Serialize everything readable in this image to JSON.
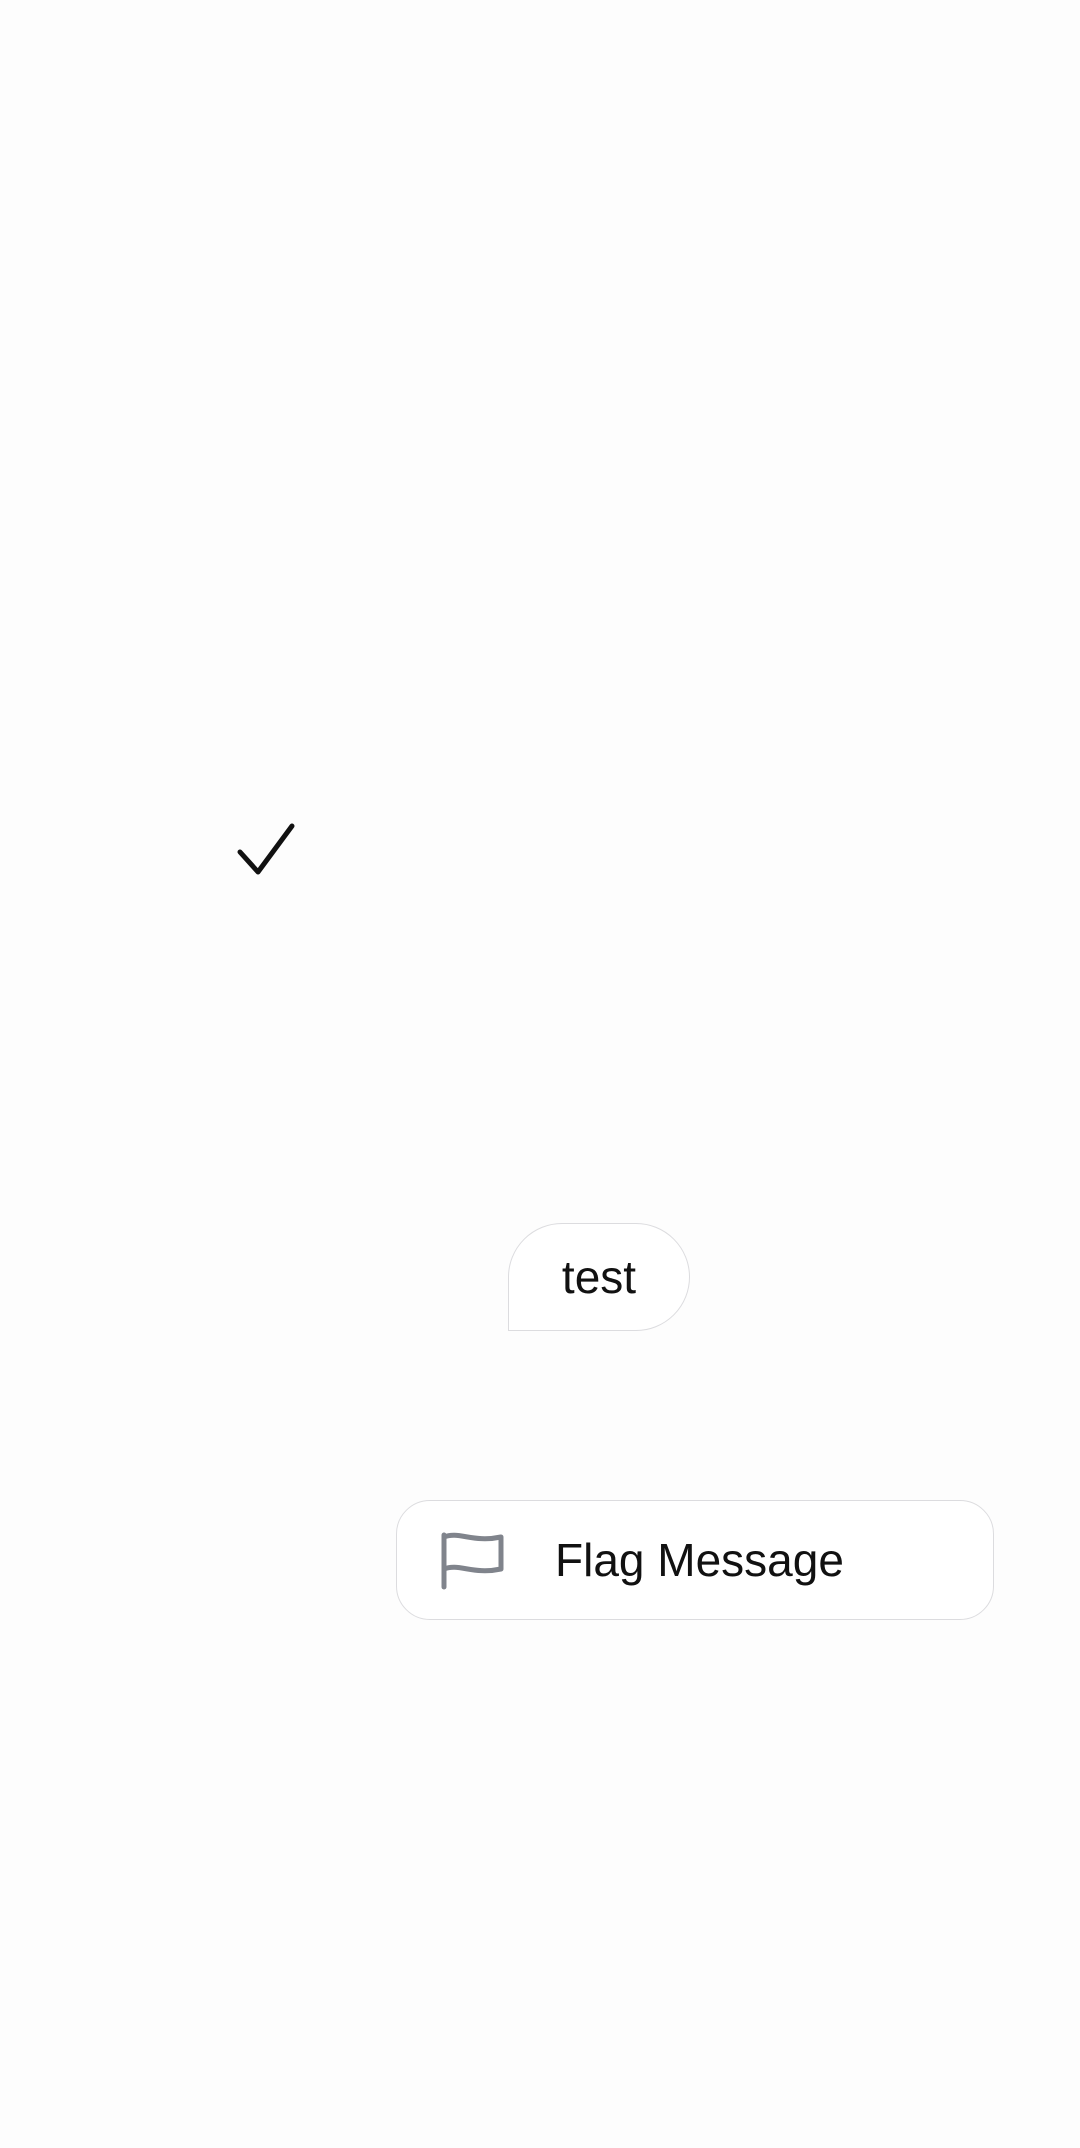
{
  "status": {
    "icon": "checkmark-icon"
  },
  "message": {
    "text": "test"
  },
  "context_menu": {
    "flag_action": {
      "icon": "flag-icon",
      "label": "Flag Message",
      "icon_color": "#80848c"
    }
  },
  "colors": {
    "background": "#fdfdfd",
    "border": "#dcdcdf",
    "text": "#111111"
  }
}
